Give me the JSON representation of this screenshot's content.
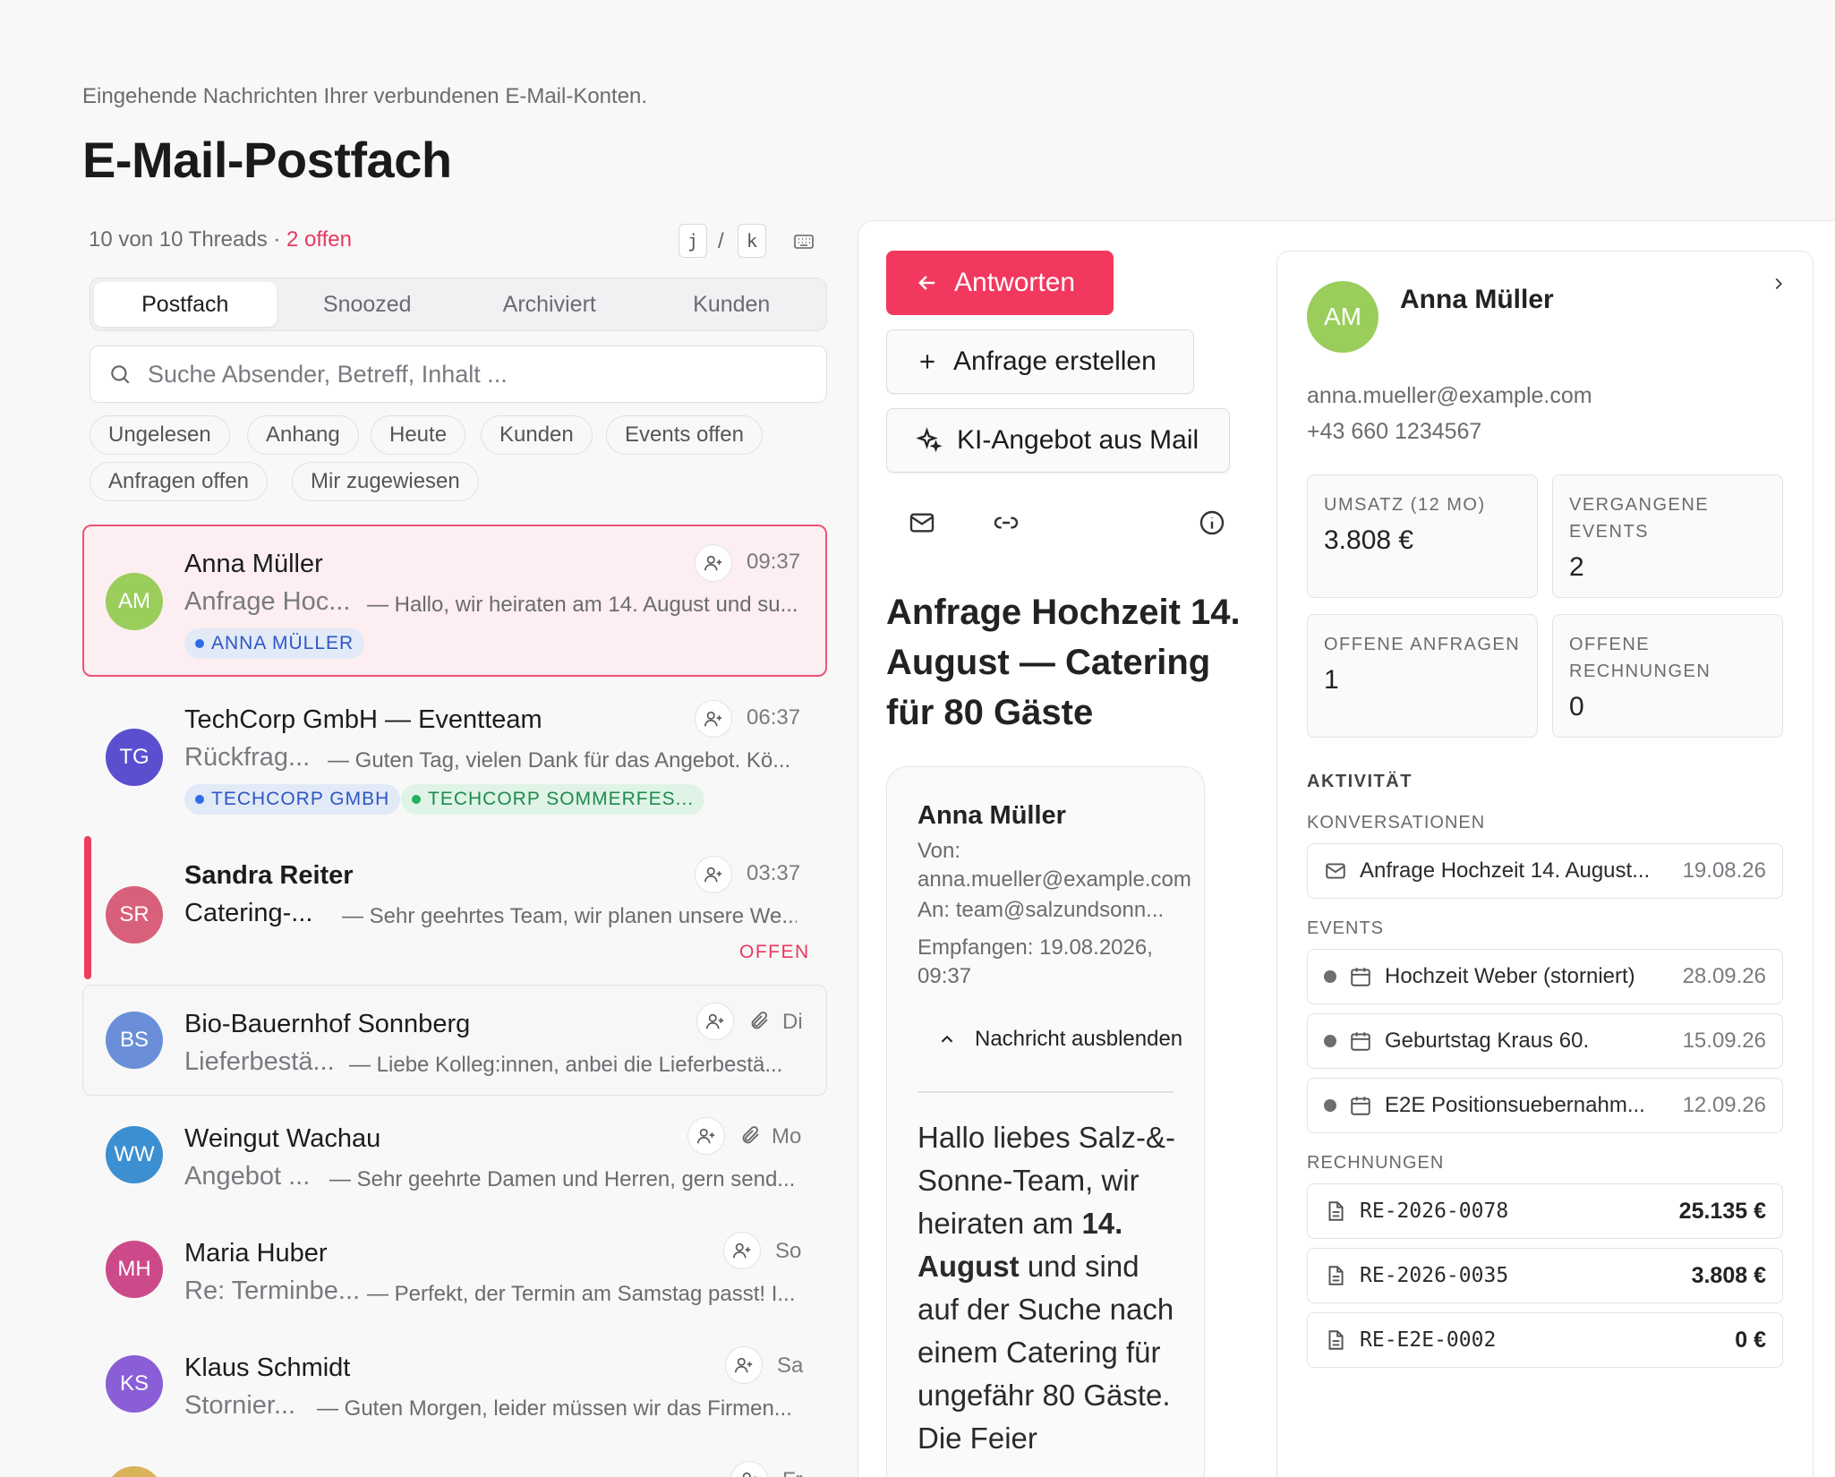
{
  "header": {
    "subtitle": "Eingehende Nachrichten Ihrer verbundenen E-Mail-Konten.",
    "title": "E-Mail-Postfach"
  },
  "toolbar": {
    "count_text": "10 von 10 Threads · ",
    "open_text": "2 offen",
    "kbd_prev": "j",
    "kbd_sep": "/",
    "kbd_next": "k"
  },
  "tabs": [
    "Postfach",
    "Snoozed",
    "Archiviert",
    "Kunden"
  ],
  "search": {
    "placeholder": "Suche Absender, Betreff, Inhalt ..."
  },
  "filters": [
    "Ungelesen",
    "Anhang",
    "Heute",
    "Kunden",
    "Events offen",
    "Anfragen offen",
    "Mir zugewiesen"
  ],
  "threads": [
    {
      "initials": "AM",
      "color": "#9acd5c",
      "sender": "Anna Müller",
      "subject": "Anfrage Hoc...",
      "snippet": "— Hallo, wir heiraten am 14. August und su...",
      "time": "09:37",
      "tags": [
        "ANNA MÜLLER"
      ]
    },
    {
      "initials": "TG",
      "color": "#5b4fcf",
      "sender": "TechCorp GmbH — Eventteam",
      "subject": "Rückfrag...",
      "snippet": "— Guten Tag, vielen Dank für das Angebot. Kö...",
      "time": "06:37",
      "tags": [
        "TECHCORP GMBH",
        "TECHCORP SOMMERFES..."
      ]
    },
    {
      "initials": "SR",
      "color": "#d9607a",
      "sender": "Sandra Reiter",
      "subject": "Catering-...",
      "snippet": "— Sehr geehrtes Team, wir planen unsere We...",
      "time": "03:37",
      "status": "OFFEN"
    },
    {
      "initials": "BS",
      "color": "#6a8fd8",
      "sender": "Bio-Bauernhof Sonnberg",
      "subject": "Lieferbestä...",
      "snippet": "— Liebe Kolleg:innen, anbei die Lieferbestä...",
      "time": "Di"
    },
    {
      "initials": "WW",
      "color": "#3c8fd0",
      "sender": "Weingut Wachau",
      "subject": "Angebot ...",
      "snippet": "— Sehr geehrte Damen und Herren, gern send...",
      "time": "Mo"
    },
    {
      "initials": "MH",
      "color": "#cc4a8a",
      "sender": "Maria Huber",
      "subject": "Re: Terminbe...",
      "snippet": "— Perfekt, der Termin am Samstag passt! I...",
      "time": "So"
    },
    {
      "initials": "KS",
      "color": "#8a5ed6",
      "sender": "Klaus Schmidt",
      "subject": "Stornier...",
      "snippet": "— Guten Morgen, leider müssen wir das Firmen...",
      "time": "Sa"
    },
    {
      "initials": "",
      "color": "#d9b35a",
      "sender": "",
      "subject": "",
      "snippet": "",
      "time": "Fr"
    }
  ],
  "actions": {
    "reply": "Antworten",
    "create_request": "Anfrage erstellen",
    "ai_offer": "KI-Angebot aus Mail"
  },
  "mail": {
    "title": "Anfrage Hochzeit 14. August — Catering für 80 Gäste",
    "from_name": "Anna Müller",
    "from_label": "Von:",
    "from_addr": "anna.mueller@example.com",
    "to": "An: team@salzundsonn...",
    "received": "Empfangen: 19.08.2026,",
    "received_time": "09:37",
    "toggle": "Nachricht ausblenden",
    "body_1": "Hallo liebes Salz-&-Sonne-Team, wir heiraten am ",
    "body_bold": "14. August",
    "body_2": " und sind auf der Suche nach einem Catering für ungefähr 80 Gäste. Die Feier"
  },
  "customer": {
    "initials": "AM",
    "color": "#9acd5c",
    "name": "Anna Müller",
    "email": "anna.mueller@example.com",
    "phone": "+43 660 1234567",
    "stats": [
      {
        "label": "UMSATZ (12 MO)",
        "value": "3.808 €"
      },
      {
        "label": "VERGANGENE EVENTS",
        "value": "2"
      },
      {
        "label": "OFFENE ANFRAGEN",
        "value": "1"
      },
      {
        "label": "OFFENE RECHNUNGEN",
        "value": "0"
      }
    ],
    "activity_label": "AKTIVITÄT",
    "conversations_label": "KONVERSATIONEN",
    "conversations": [
      {
        "title": "Anfrage Hochzeit 14. August...",
        "date": "19.08.26"
      }
    ],
    "events_label": "EVENTS",
    "events": [
      {
        "title": "Hochzeit Weber (storniert)",
        "date": "28.09.26"
      },
      {
        "title": "Geburtstag Kraus 60.",
        "date": "15.09.26"
      },
      {
        "title": "E2E Positionsuebernahm...",
        "date": "12.09.26"
      }
    ],
    "invoices_label": "RECHNUNGEN",
    "invoices": [
      {
        "number": "RE-2026-0078",
        "amount": "25.135 €"
      },
      {
        "number": "RE-2026-0035",
        "amount": "3.808 €"
      },
      {
        "number": "RE-E2E-0002",
        "amount": "0 €"
      }
    ]
  }
}
